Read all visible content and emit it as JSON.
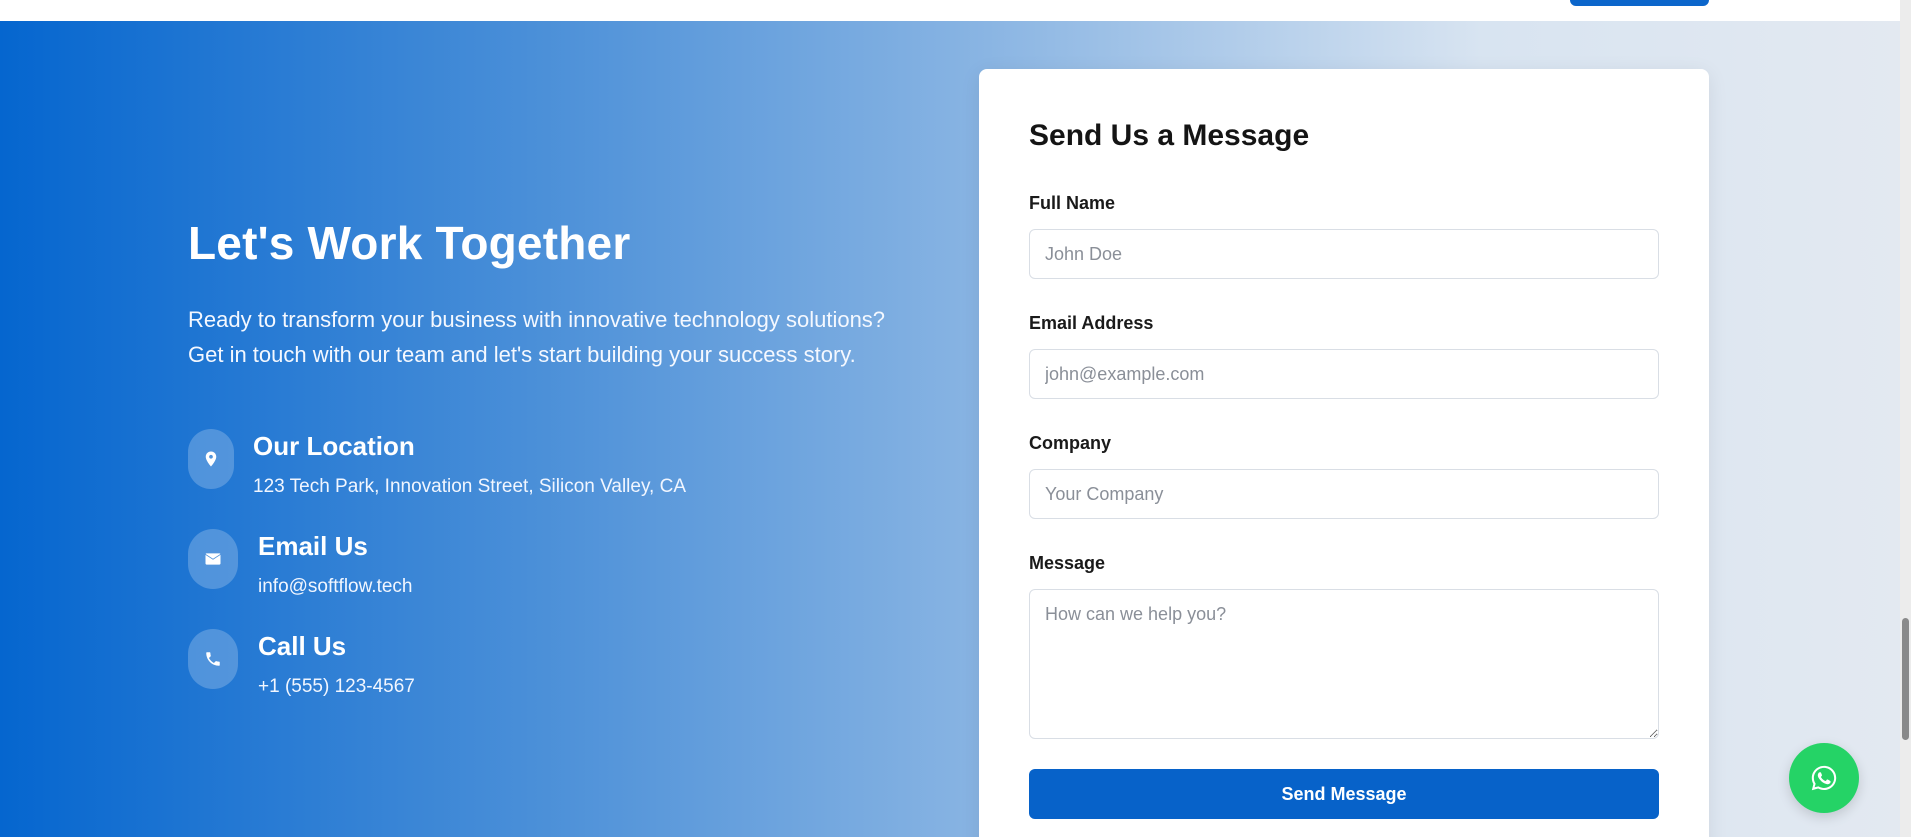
{
  "contact": {
    "heading": "Let's Work Together",
    "lead_line1": "Ready to transform your business with innovative technology solutions?",
    "lead_line2": "Get in touch with our team and let's start building your success story.",
    "items": [
      {
        "icon": "location-pin-icon",
        "title": "Our Location",
        "value": "123 Tech Park, Innovation Street, Silicon Valley, CA"
      },
      {
        "icon": "envelope-icon",
        "title": "Email Us",
        "value": "info@softflow.tech"
      },
      {
        "icon": "phone-icon",
        "title": "Call Us",
        "value": "+1 (555) 123-4567"
      }
    ]
  },
  "form": {
    "title": "Send Us a Message",
    "full_name": {
      "label": "Full Name",
      "placeholder": "John Doe",
      "value": ""
    },
    "email": {
      "label": "Email Address",
      "placeholder": "john@example.com",
      "value": ""
    },
    "company": {
      "label": "Company",
      "placeholder": "Your Company",
      "value": ""
    },
    "message": {
      "label": "Message",
      "placeholder": "How can we help you?",
      "value": ""
    },
    "submit_label": "Send Message"
  },
  "floating": {
    "whatsapp_icon": "whatsapp-icon",
    "whatsapp_color": "#25d366"
  },
  "colors": {
    "primary": "#0762c9",
    "gradient_start": "#0566cf",
    "gradient_end": "#e3e9f1"
  }
}
